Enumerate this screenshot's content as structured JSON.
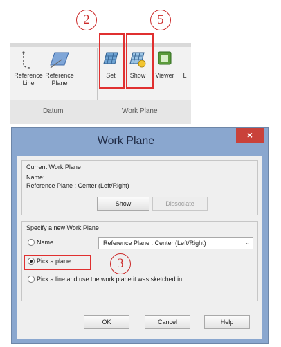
{
  "ribbon": {
    "buttons": [
      {
        "label_line1": "Reference",
        "label_line2": "Line"
      },
      {
        "label_line1": "Reference",
        "label_line2": "Plane"
      },
      {
        "label_line1": "Set",
        "label_line2": ""
      },
      {
        "label_line1": "Show",
        "label_line2": ""
      },
      {
        "label_line1": "Viewer",
        "label_line2": ""
      },
      {
        "label_line1": "L",
        "label_line2": ""
      }
    ],
    "panels": {
      "datum": "Datum",
      "work_plane": "Work Plane"
    }
  },
  "annotations": {
    "step_set": "2",
    "step_show": "5",
    "step_pick": "3"
  },
  "dialog": {
    "title": "Work Plane",
    "close": "×",
    "current": {
      "group_label": "Current Work Plane",
      "name_label": "Name:",
      "name_value": "Reference Plane : Center (Left/Right)",
      "show_btn": "Show",
      "dissociate_btn": "Dissociate"
    },
    "specify": {
      "group_label": "Specify a new Work Plane",
      "opt_name": "Name",
      "name_select": "Reference Plane : Center (Left/Right)",
      "opt_pick": "Pick a plane",
      "opt_line": "Pick a line and use the work plane it was sketched in"
    },
    "buttons": {
      "ok": "OK",
      "cancel": "Cancel",
      "help": "Help"
    }
  },
  "colors": {
    "highlight": "#e03030",
    "titlebar": "#8aa7cf",
    "close": "#c9423a"
  }
}
